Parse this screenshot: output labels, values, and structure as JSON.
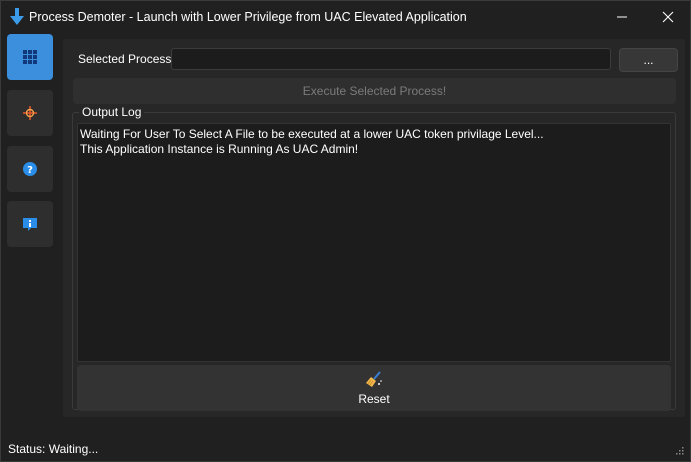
{
  "window": {
    "title": "Process Demoter - Launch with Lower Privilege from UAC Elevated Application"
  },
  "nav": {
    "items": [
      {
        "name": "main",
        "icon": "grid-icon",
        "active": true
      },
      {
        "name": "target",
        "icon": "crosshair-icon",
        "active": false
      },
      {
        "name": "help",
        "icon": "help-icon",
        "active": false
      },
      {
        "name": "about",
        "icon": "info-icon",
        "active": false
      }
    ]
  },
  "process": {
    "label": "Selected Process:",
    "value": "",
    "placeholder": "",
    "browse_label": "...",
    "execute_label": "Execute Selected Process!"
  },
  "log": {
    "legend": "Output Log",
    "lines": [
      "Waiting For User To Select A File to be executed at a lower UAC token privilage Level...",
      "This Application Instance is Running As UAC Admin!"
    ],
    "reset_label": "Reset"
  },
  "status": {
    "text": "Status: Waiting..."
  },
  "colors": {
    "accent": "#3b8fdc",
    "background": "#202020",
    "panel": "#272727",
    "disabled_text": "#7b7b7b"
  }
}
